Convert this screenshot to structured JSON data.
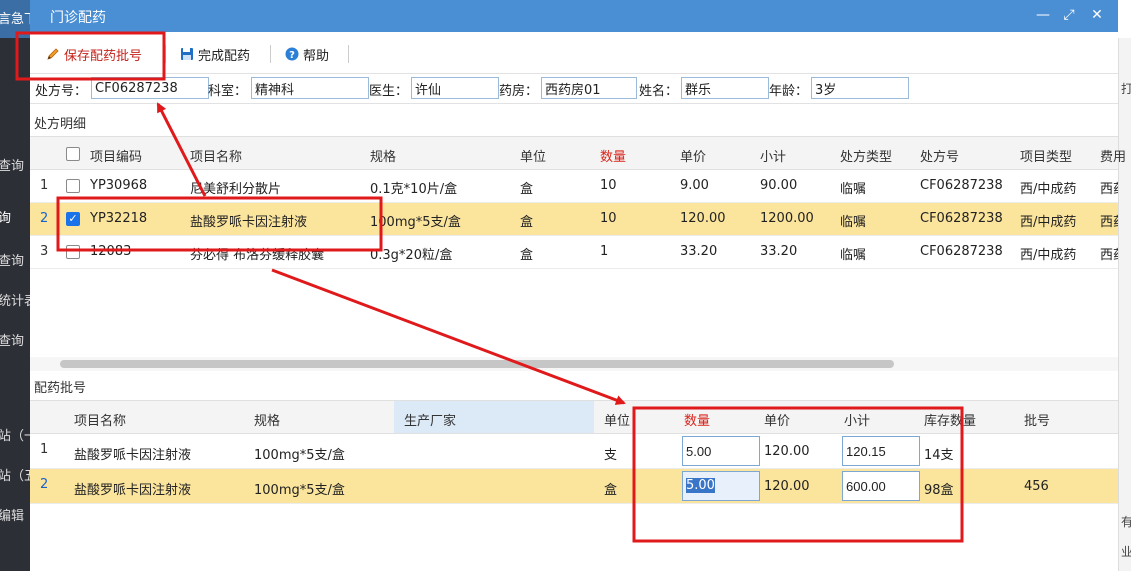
{
  "sidebar": {
    "items": [
      "言急下",
      "查询",
      "询",
      "查询",
      "统计表",
      "查询",
      "",
      "站（一",
      "站（五",
      "编辑"
    ]
  },
  "right_strip": {
    "items": [
      "打",
      "有",
      "业"
    ]
  },
  "dialog": {
    "title": "门诊配药",
    "window_buttons": [
      "—",
      "⤢",
      "✕"
    ]
  },
  "toolbar": {
    "save_batch_label": "保存配药批号",
    "complete_label": "完成配药",
    "help_label": "帮助"
  },
  "form": {
    "prescription_no_label": "处方号：",
    "prescription_no": "CF06287238",
    "department_label": "科室：",
    "department": "精神科",
    "doctor_label": "医生：",
    "doctor": "许仙",
    "pharmacy_label": "药房：",
    "pharmacy": "西药房01",
    "name_label": "姓名：",
    "name": "群乐",
    "age_label": "年龄：",
    "age": "3岁"
  },
  "prescription_detail": {
    "section_title": "处方明细",
    "columns": [
      "项目编码",
      "项目名称",
      "规格",
      "单位",
      "数量",
      "单价",
      "小计",
      "处方类型",
      "处方号",
      "项目类型",
      "费用"
    ],
    "rows": [
      {
        "no": "1",
        "checked": false,
        "code": "YP30968",
        "name": "尼美舒利分散片",
        "spec": "0.1克*10片/盒",
        "unit": "盒",
        "qty": "10",
        "price": "9.00",
        "subtotal": "90.00",
        "rx_type": "临嘱",
        "rx_no": "CF06287238",
        "item_type": "西/中成药",
        "fee": "西药"
      },
      {
        "no": "2",
        "checked": true,
        "code": "YP32218",
        "name": "盐酸罗哌卡因注射液",
        "spec": "100mg*5支/盒",
        "unit": "盒",
        "qty": "10",
        "price": "120.00",
        "subtotal": "1200.00",
        "rx_type": "临嘱",
        "rx_no": "CF06287238",
        "item_type": "西/中成药",
        "fee": "西药"
      },
      {
        "no": "3",
        "checked": false,
        "code": "12083",
        "name": "芬必得 布洛芬缓释胶囊",
        "spec": "0.3g*20粒/盒",
        "unit": "盒",
        "qty": "1",
        "price": "33.20",
        "subtotal": "33.20",
        "rx_type": "临嘱",
        "rx_no": "CF06287238",
        "item_type": "西/中成药",
        "fee": "西药"
      }
    ]
  },
  "batch": {
    "section_title": "配药批号",
    "columns": [
      "项目名称",
      "规格",
      "生产厂家",
      "单位",
      "数量",
      "单价",
      "小计",
      "库存数量",
      "批号"
    ],
    "rows": [
      {
        "no": "1",
        "name": "盐酸罗哌卡因注射液",
        "spec": "100mg*5支/盒",
        "maker": "",
        "unit": "支",
        "qty": "5.00",
        "price": "120.00",
        "subtotal": "120.15",
        "stock": "14支",
        "batch_no": ""
      },
      {
        "no": "2",
        "name": "盐酸罗哌卡因注射液",
        "spec": "100mg*5支/盒",
        "maker": "",
        "unit": "盒",
        "qty": "5.00",
        "price": "120.00",
        "subtotal": "600.00",
        "stock": "98盒",
        "batch_no": "456"
      }
    ]
  },
  "colors": {
    "titlebar": "#4a8fd4",
    "selected_row": "#fbe49c",
    "required_header": "#d9251c",
    "annotation": "#e0191b"
  }
}
